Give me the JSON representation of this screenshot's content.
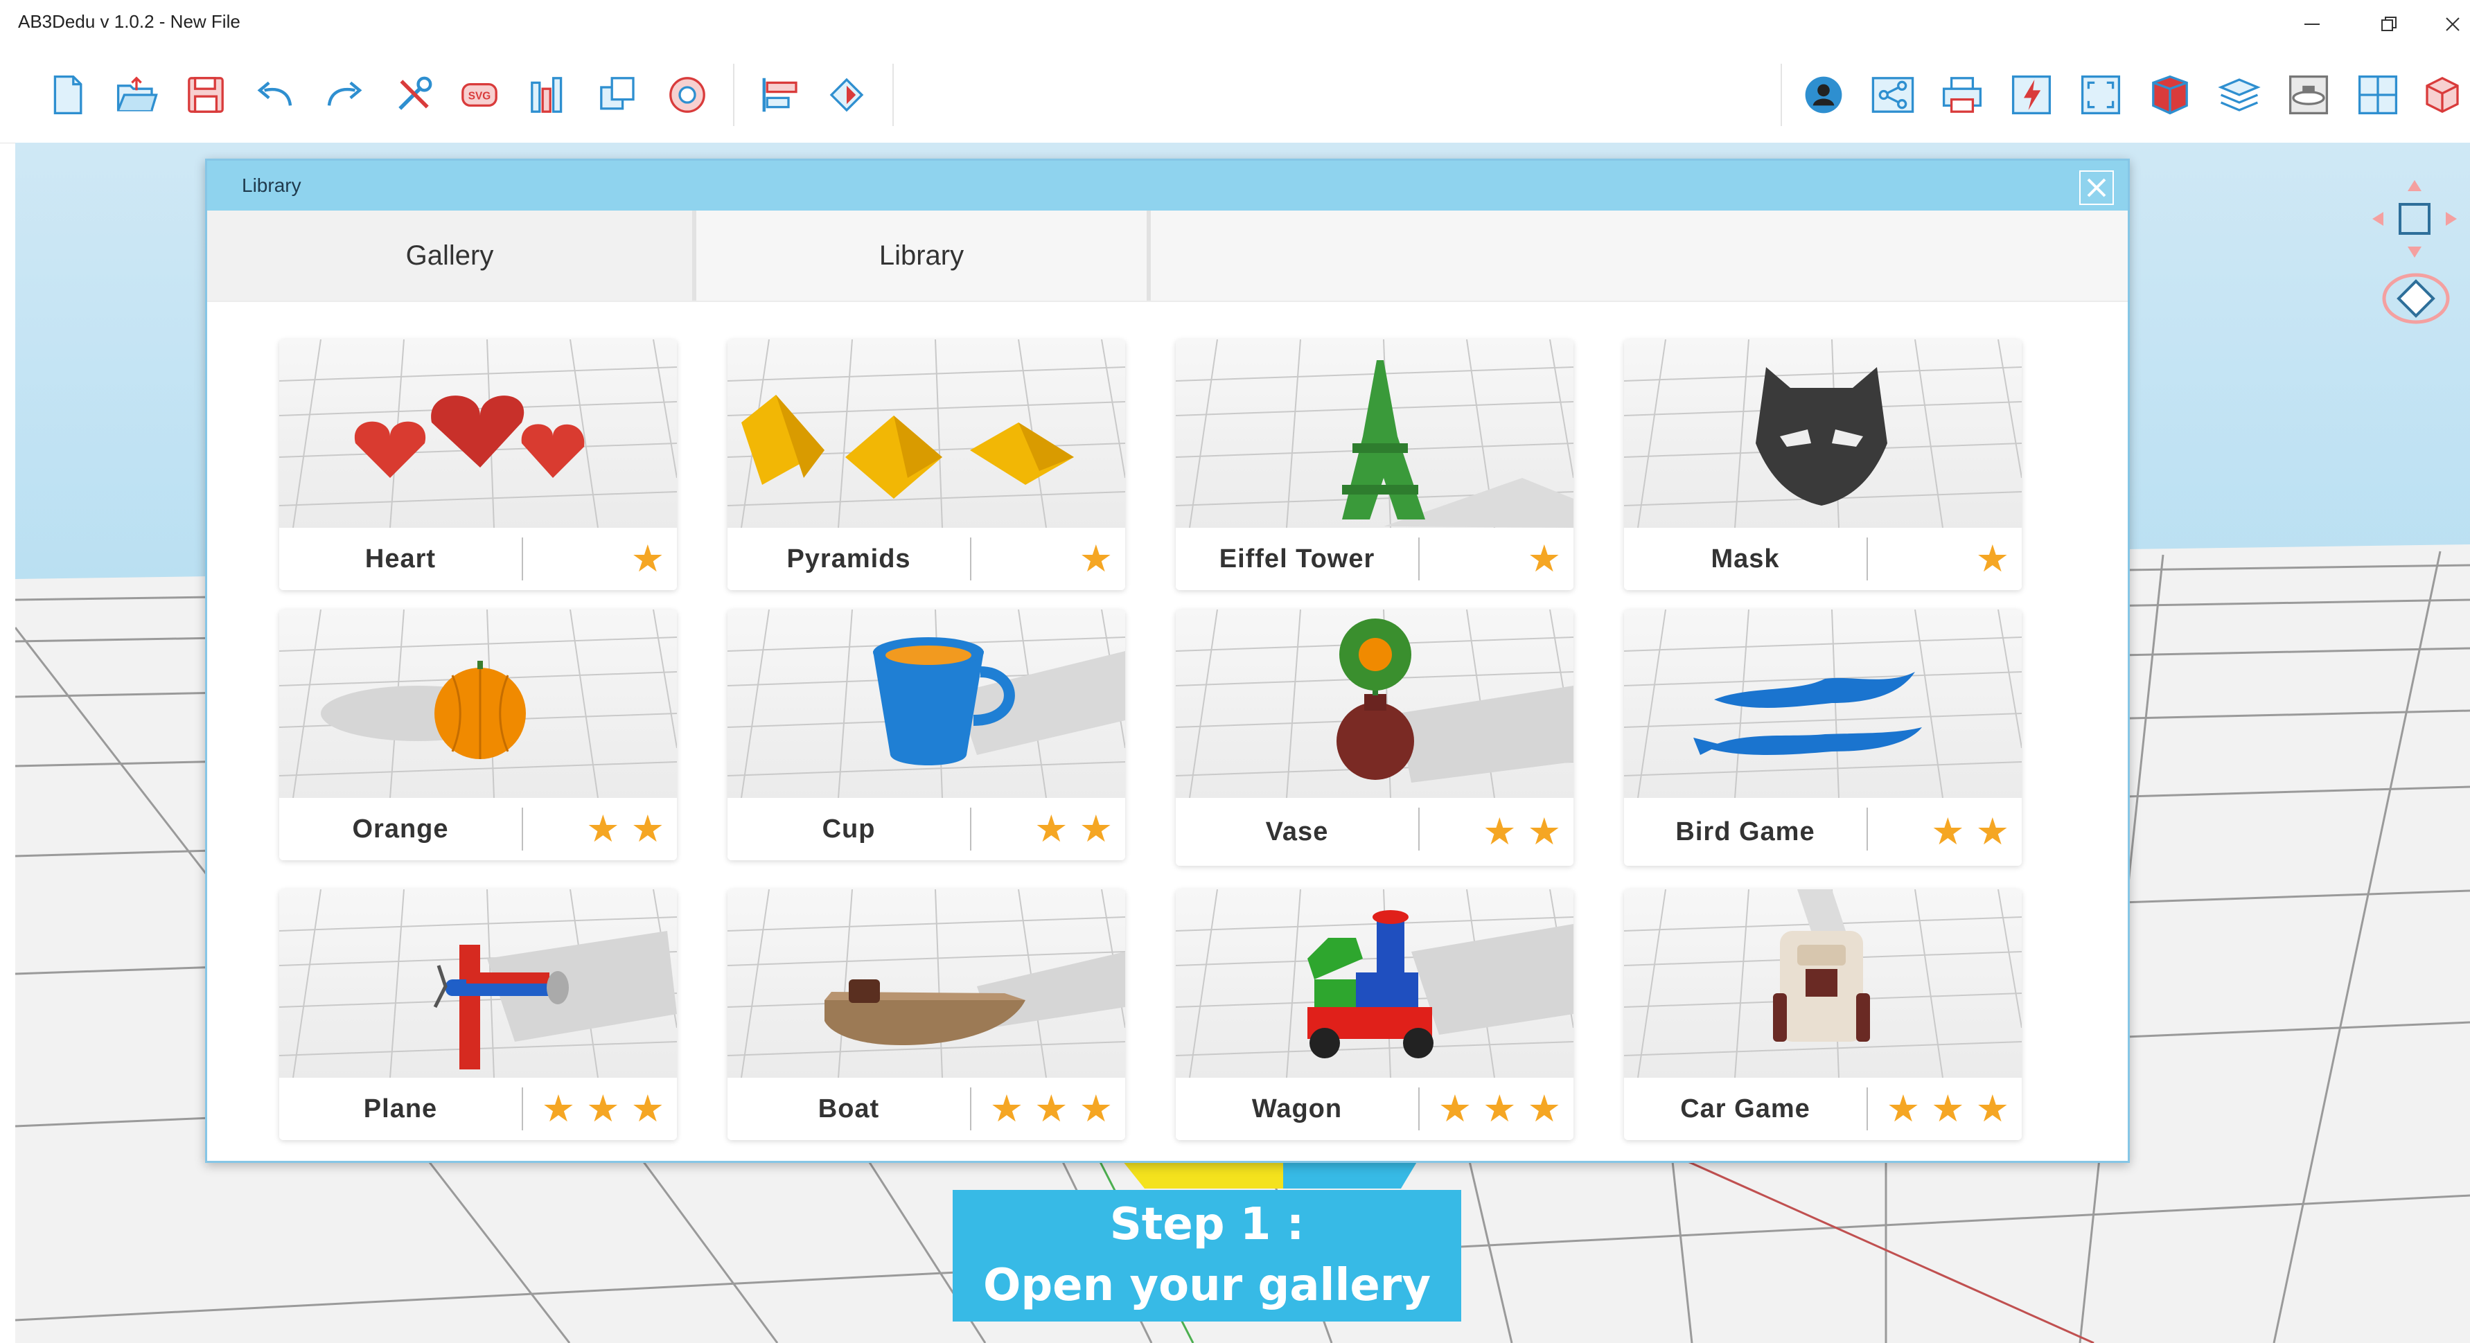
{
  "window": {
    "title": "AB3Dedu v 1.0.2 - New File",
    "controls": [
      "minimize-icon",
      "restore-icon",
      "close-icon"
    ]
  },
  "toolbar": {
    "left_icons": [
      "new-file-icon",
      "open-folder-icon",
      "save-icon",
      "undo-icon",
      "redo-icon",
      "tools-icon",
      "svg-import-icon",
      "library-books-icon",
      "duplicate-icon",
      "help-lifebuoy-icon",
      "align-icon",
      "mirror-icon"
    ],
    "right_icons": [
      "user-account-icon",
      "share-icon",
      "print-icon",
      "slice-lightning-icon",
      "fullscreen-icon",
      "view-cube-icon",
      "layers-icon",
      "printer-bed-icon",
      "grid-view-icon",
      "3d-box-icon"
    ],
    "accent": "#2e8fd0"
  },
  "dialog": {
    "title": "Library",
    "tabs": [
      {
        "label": "Gallery",
        "active": true
      },
      {
        "label": "Library",
        "active": false
      }
    ],
    "header_color": "#8fd3ee"
  },
  "gallery": {
    "items": [
      {
        "name": "Heart",
        "stars": 1
      },
      {
        "name": "Pyramids",
        "stars": 1
      },
      {
        "name": "Eiffel Tower",
        "stars": 1
      },
      {
        "name": "Mask",
        "stars": 1
      },
      {
        "name": "Orange",
        "stars": 2
      },
      {
        "name": "Cup",
        "stars": 2
      },
      {
        "name": "Vase",
        "stars": 2
      },
      {
        "name": "Bird Game",
        "stars": 2
      },
      {
        "name": "Plane",
        "stars": 3
      },
      {
        "name": "Boat",
        "stars": 3
      },
      {
        "name": "Wagon",
        "stars": 3
      },
      {
        "name": "Car Game",
        "stars": 3
      }
    ],
    "star_color": "#f5a623"
  },
  "callout": {
    "line1": "Step 1 :",
    "line2": "Open your gallery",
    "color": "#37bae6"
  }
}
